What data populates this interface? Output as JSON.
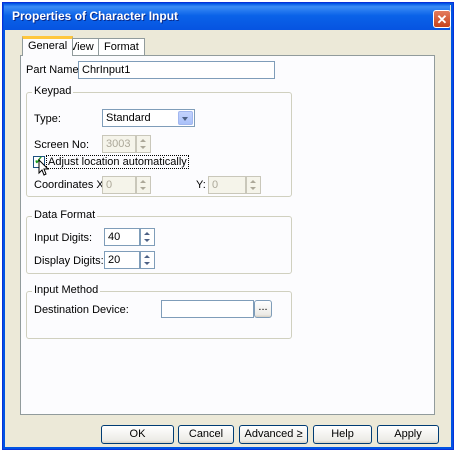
{
  "window": {
    "title": "Properties of Character Input"
  },
  "tabs": [
    {
      "label": "General"
    },
    {
      "label": "View"
    },
    {
      "label": "Format"
    }
  ],
  "part_name": {
    "label": "Part Name:",
    "value": "ChrInput1"
  },
  "keypad": {
    "legend": "Keypad",
    "type_label": "Type:",
    "type_value": "Standard",
    "screen_no_label": "Screen No:",
    "screen_no_value": "3003",
    "adjust_label": "Adjust location automatically",
    "adjust_checked": true,
    "coordinates_label": "Coordinates X:",
    "x_value": "0",
    "y_label": "Y:",
    "y_value": "0"
  },
  "data_format": {
    "legend": "Data Format",
    "input_digits_label": "Input Digits:",
    "input_digits_value": "40",
    "display_digits_label": "Display Digits:",
    "display_digits_value": "20"
  },
  "input_method": {
    "legend": "Input Method",
    "destination_label": "Destination Device:",
    "destination_value": "",
    "browse_label": "..."
  },
  "buttons": {
    "ok": "OK",
    "cancel": "Cancel",
    "advanced": "Advanced ≥",
    "help": "Help",
    "apply": "Apply"
  },
  "colors": {
    "title_bar": "#0a5fe8",
    "dialog_bg": "#ece9d8",
    "close_button": "#c5421c"
  }
}
